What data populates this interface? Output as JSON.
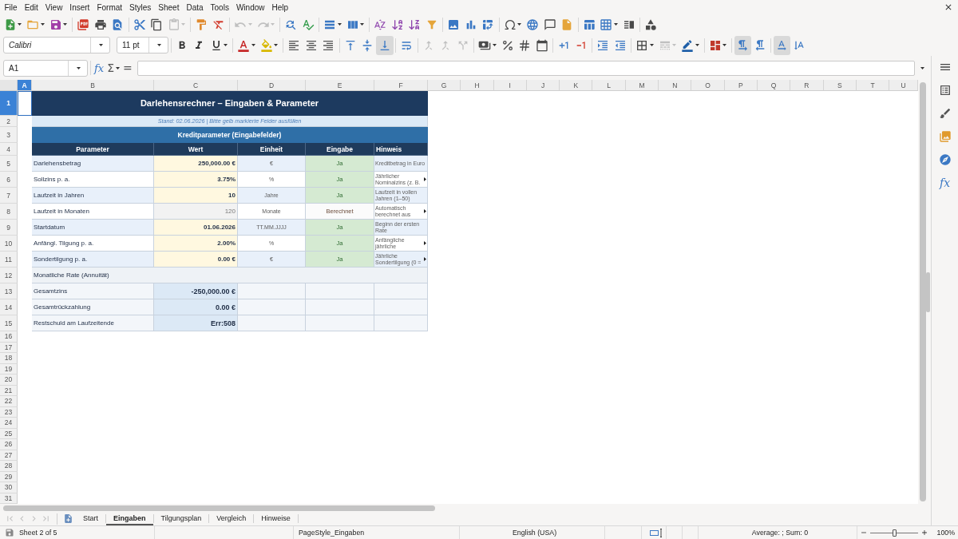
{
  "menu": [
    "File",
    "Edit",
    "View",
    "Insert",
    "Format",
    "Styles",
    "Sheet",
    "Data",
    "Tools",
    "Window",
    "Help"
  ],
  "standard_toolbar": [
    [
      {
        "kind": "new",
        "disabled": false
      },
      {
        "kind": "open",
        "disabled": false
      },
      {
        "kind": "save",
        "disabled": false
      }
    ],
    [
      {
        "kind": "pdf",
        "disabled": false
      },
      {
        "kind": "print",
        "disabled": false
      },
      {
        "kind": "preview",
        "disabled": false
      }
    ],
    [
      {
        "kind": "cut",
        "disabled": false
      },
      {
        "kind": "copy",
        "disabled": false
      },
      {
        "kind": "paste",
        "disabled": true
      }
    ],
    [
      {
        "kind": "clone",
        "disabled": false
      },
      {
        "kind": "clear",
        "disabled": false
      }
    ],
    [
      {
        "kind": "undo",
        "disabled": true
      },
      {
        "kind": "redo",
        "disabled": true
      }
    ],
    [
      {
        "kind": "find",
        "disabled": false
      },
      {
        "kind": "spelling",
        "disabled": false
      }
    ],
    [
      {
        "kind": "rows",
        "disabled": false
      },
      {
        "kind": "columns",
        "disabled": false
      }
    ],
    [
      {
        "kind": "sort",
        "disabled": false
      },
      {
        "kind": "ascending",
        "disabled": false
      },
      {
        "kind": "descending",
        "disabled": false
      },
      {
        "kind": "filter",
        "disabled": false
      }
    ],
    [
      {
        "kind": "image",
        "disabled": false
      },
      {
        "kind": "chart",
        "disabled": false
      },
      {
        "kind": "pivot",
        "disabled": false
      }
    ],
    [
      {
        "kind": "special",
        "disabled": false
      },
      {
        "kind": "hyperlink",
        "disabled": false
      },
      {
        "kind": "comment",
        "disabled": false
      },
      {
        "kind": "headers",
        "disabled": false
      }
    ],
    [
      {
        "kind": "printarea",
        "disabled": false
      },
      {
        "kind": "freeze",
        "disabled": false
      },
      {
        "kind": "split",
        "disabled": false
      }
    ],
    [
      {
        "kind": "shapes",
        "disabled": false
      }
    ]
  ],
  "formatting_toolbar": {
    "font_name": "Calibri",
    "font_size": "11 pt",
    "groups": [
      [
        {
          "kind": "bold",
          "on": false,
          "disabled": false
        },
        {
          "kind": "italic",
          "on": false,
          "disabled": false
        },
        {
          "kind": "underline",
          "on": false,
          "disabled": false
        }
      ],
      [
        {
          "kind": "fontcolor",
          "on": false,
          "disabled": false
        },
        {
          "kind": "highlight",
          "on": false,
          "disabled": false
        }
      ],
      [
        {
          "kind": "left",
          "on": false,
          "disabled": false
        },
        {
          "kind": "center",
          "on": false,
          "disabled": false
        },
        {
          "kind": "right",
          "on": false,
          "disabled": false
        }
      ],
      [
        {
          "kind": "top",
          "on": false,
          "disabled": false
        },
        {
          "kind": "middle",
          "on": false,
          "disabled": false
        },
        {
          "kind": "bottom",
          "on": true,
          "disabled": false
        }
      ],
      [
        {
          "kind": "wrap",
          "on": false,
          "disabled": false
        }
      ],
      [
        {
          "kind": "mergecenter",
          "on": false,
          "disabled": true
        },
        {
          "kind": "merge",
          "on": false,
          "disabled": true
        },
        {
          "kind": "unmerge",
          "on": false,
          "disabled": true
        }
      ],
      [
        {
          "kind": "currency",
          "on": false,
          "disabled": false
        },
        {
          "kind": "percent",
          "on": false,
          "disabled": false
        },
        {
          "kind": "number",
          "on": false,
          "disabled": false
        },
        {
          "kind": "date",
          "on": false,
          "disabled": false
        }
      ],
      [
        {
          "kind": "adddecimal",
          "on": false,
          "disabled": false
        },
        {
          "kind": "deldecimal",
          "on": false,
          "disabled": false
        }
      ],
      [
        {
          "kind": "indent",
          "on": false,
          "disabled": false
        },
        {
          "kind": "outdent",
          "on": false,
          "disabled": false
        }
      ],
      [
        {
          "kind": "borders",
          "on": false,
          "disabled": false
        },
        {
          "kind": "borderstyle",
          "on": false,
          "disabled": true
        },
        {
          "kind": "bordercolor",
          "on": false,
          "disabled": false
        }
      ],
      [
        {
          "kind": "conditional",
          "on": false,
          "disabled": false
        }
      ],
      [
        {
          "kind": "ltr",
          "on": true,
          "disabled": false
        },
        {
          "kind": "rtl",
          "on": false,
          "disabled": false
        }
      ],
      [
        {
          "kind": "horizontal",
          "on": true,
          "disabled": false
        },
        {
          "kind": "vertical",
          "on": false,
          "disabled": false
        }
      ]
    ]
  },
  "formula_bar": {
    "name_box": "A1",
    "function_wizard": "fx",
    "sum": "Σ",
    "formula": "="
  },
  "sidebar": [
    {
      "kind": "properties"
    },
    {
      "kind": "styles"
    },
    {
      "kind": "gallery"
    },
    {
      "kind": "navigator"
    },
    {
      "kind": "functions",
      "label": "fx"
    }
  ],
  "sheet": {
    "columns": [
      {
        "label": "A",
        "selected": true
      },
      {
        "label": "B",
        "selected": false
      },
      {
        "label": "C",
        "selected": false
      },
      {
        "label": "D",
        "selected": false
      },
      {
        "label": "E",
        "selected": false
      },
      {
        "label": "F",
        "selected": false
      },
      {
        "label": "G",
        "selected": false
      },
      {
        "label": "H",
        "selected": false
      },
      {
        "label": "I",
        "selected": false
      },
      {
        "label": "J",
        "selected": false
      },
      {
        "label": "K",
        "selected": false
      },
      {
        "label": "L",
        "selected": false
      },
      {
        "label": "M",
        "selected": false
      },
      {
        "label": "N",
        "selected": false
      },
      {
        "label": "O",
        "selected": false
      },
      {
        "label": "P",
        "selected": false
      },
      {
        "label": "Q",
        "selected": false
      },
      {
        "label": "R",
        "selected": false
      },
      {
        "label": "S",
        "selected": false
      },
      {
        "label": "T",
        "selected": false
      },
      {
        "label": "U",
        "selected": false
      }
    ],
    "rows": [
      {
        "label": "1",
        "selected": true,
        "kind": "title",
        "text": "Darlehensrechner – Eingaben & Parameter"
      },
      {
        "label": "2",
        "selected": false,
        "kind": "note",
        "text": "Stand: 02.06.2026 | Bitte gelb markierte Felder ausfüllen"
      },
      {
        "label": "3",
        "selected": false,
        "kind": "section",
        "text": "Kreditparameter (Eingabefelder)"
      },
      {
        "label": "4",
        "selected": false,
        "kind": "header",
        "cells": [
          "Parameter",
          "Wert",
          "Einheit",
          "Eingabe",
          "Hinweis"
        ]
      },
      {
        "label": "5",
        "selected": false,
        "kind": "input",
        "parameter": "Darlehensbetrag",
        "value": "250,000.00 €",
        "unit": "€",
        "entry": "Ja",
        "hint": "Kreditbetrag in Euro",
        "hint_clipped": false
      },
      {
        "label": "6",
        "selected": false,
        "kind": "input",
        "parameter": "Sollzins p. a.",
        "value": "3.75%",
        "unit": "%",
        "entry": "Ja",
        "hint": "Jährlicher Nominalzins (z. B.",
        "hint_clipped": true
      },
      {
        "label": "7",
        "selected": false,
        "kind": "input",
        "parameter": "Laufzeit in Jahren",
        "value": "10",
        "unit": "Jahre",
        "entry": "Ja",
        "hint": "Laufzeit in vollen Jahren (1–50)",
        "hint_clipped": false
      },
      {
        "label": "8",
        "selected": false,
        "kind": "computed",
        "parameter": "Laufzeit in Monaten",
        "value": "120",
        "unit": "Monate",
        "entry": "Berechnet",
        "hint": "Automatisch berechnet aus",
        "hint_clipped": true
      },
      {
        "label": "9",
        "selected": false,
        "kind": "input",
        "parameter": "Startdatum",
        "value": "01.06.2026",
        "unit": "TT.MM.JJJJ",
        "entry": "Ja",
        "hint": "Beginn der ersten Rate",
        "hint_clipped": false
      },
      {
        "label": "10",
        "selected": false,
        "kind": "input",
        "parameter": "Anfängl. Tilgung p. a.",
        "value": "2.00%",
        "unit": "%",
        "entry": "Ja",
        "hint": "Anfängliche jährliche",
        "hint_clipped": true
      },
      {
        "label": "11",
        "selected": false,
        "kind": "input",
        "parameter": "Sondertilgung p. a.",
        "value": "0.00 €",
        "unit": "€",
        "entry": "Ja",
        "hint": "Jährliche Sondertilgung (0 =",
        "hint_clipped": true
      },
      {
        "label": "12",
        "selected": false,
        "kind": "group",
        "parameter": "Monatliche Rate (Annuität)"
      },
      {
        "label": "13",
        "selected": false,
        "kind": "result",
        "parameter": "Gesamtzins",
        "value": "-250,000.00 €"
      },
      {
        "label": "14",
        "selected": false,
        "kind": "result",
        "parameter": "Gesamtrückzahlung",
        "value": "0.00 €"
      },
      {
        "label": "15",
        "selected": false,
        "kind": "result",
        "parameter": "Restschuld am Laufzeitende",
        "value": "Err:508"
      },
      {
        "label": "16",
        "selected": false,
        "kind": "empty"
      },
      {
        "label": "17",
        "selected": false,
        "kind": "empty"
      },
      {
        "label": "18",
        "selected": false,
        "kind": "empty"
      },
      {
        "label": "19",
        "selected": false,
        "kind": "empty"
      },
      {
        "label": "20",
        "selected": false,
        "kind": "empty"
      },
      {
        "label": "21",
        "selected": false,
        "kind": "empty"
      },
      {
        "label": "22",
        "selected": false,
        "kind": "empty"
      },
      {
        "label": "23",
        "selected": false,
        "kind": "empty"
      },
      {
        "label": "24",
        "selected": false,
        "kind": "empty"
      },
      {
        "label": "25",
        "selected": false,
        "kind": "empty"
      },
      {
        "label": "26",
        "selected": false,
        "kind": "empty"
      },
      {
        "label": "27",
        "selected": false,
        "kind": "empty"
      },
      {
        "label": "28",
        "selected": false,
        "kind": "empty"
      },
      {
        "label": "29",
        "selected": false,
        "kind": "empty"
      },
      {
        "label": "30",
        "selected": false,
        "kind": "empty"
      },
      {
        "label": "31",
        "selected": false,
        "kind": "empty"
      }
    ]
  },
  "sheet_nav": [
    {
      "kind": "first",
      "disabled": true
    },
    {
      "kind": "previous",
      "disabled": true
    },
    {
      "kind": "next",
      "disabled": true
    },
    {
      "kind": "last",
      "disabled": true
    }
  ],
  "sheet_tabs": [
    {
      "label": "Start",
      "selected": false
    },
    {
      "label": "Eingaben",
      "selected": true
    },
    {
      "label": "Tilgungsplan",
      "selected": false
    },
    {
      "label": "Vergleich",
      "selected": false
    },
    {
      "label": "Hinweise",
      "selected": false
    }
  ],
  "status_bar": {
    "sheet": "Sheet 2 of 5",
    "page_style": "PageStyle_Eingaben",
    "language": "English (USA)",
    "summary": "Average: ; Sum: 0",
    "zoom": {
      "level": 0.5,
      "reading": "100%"
    }
  }
}
